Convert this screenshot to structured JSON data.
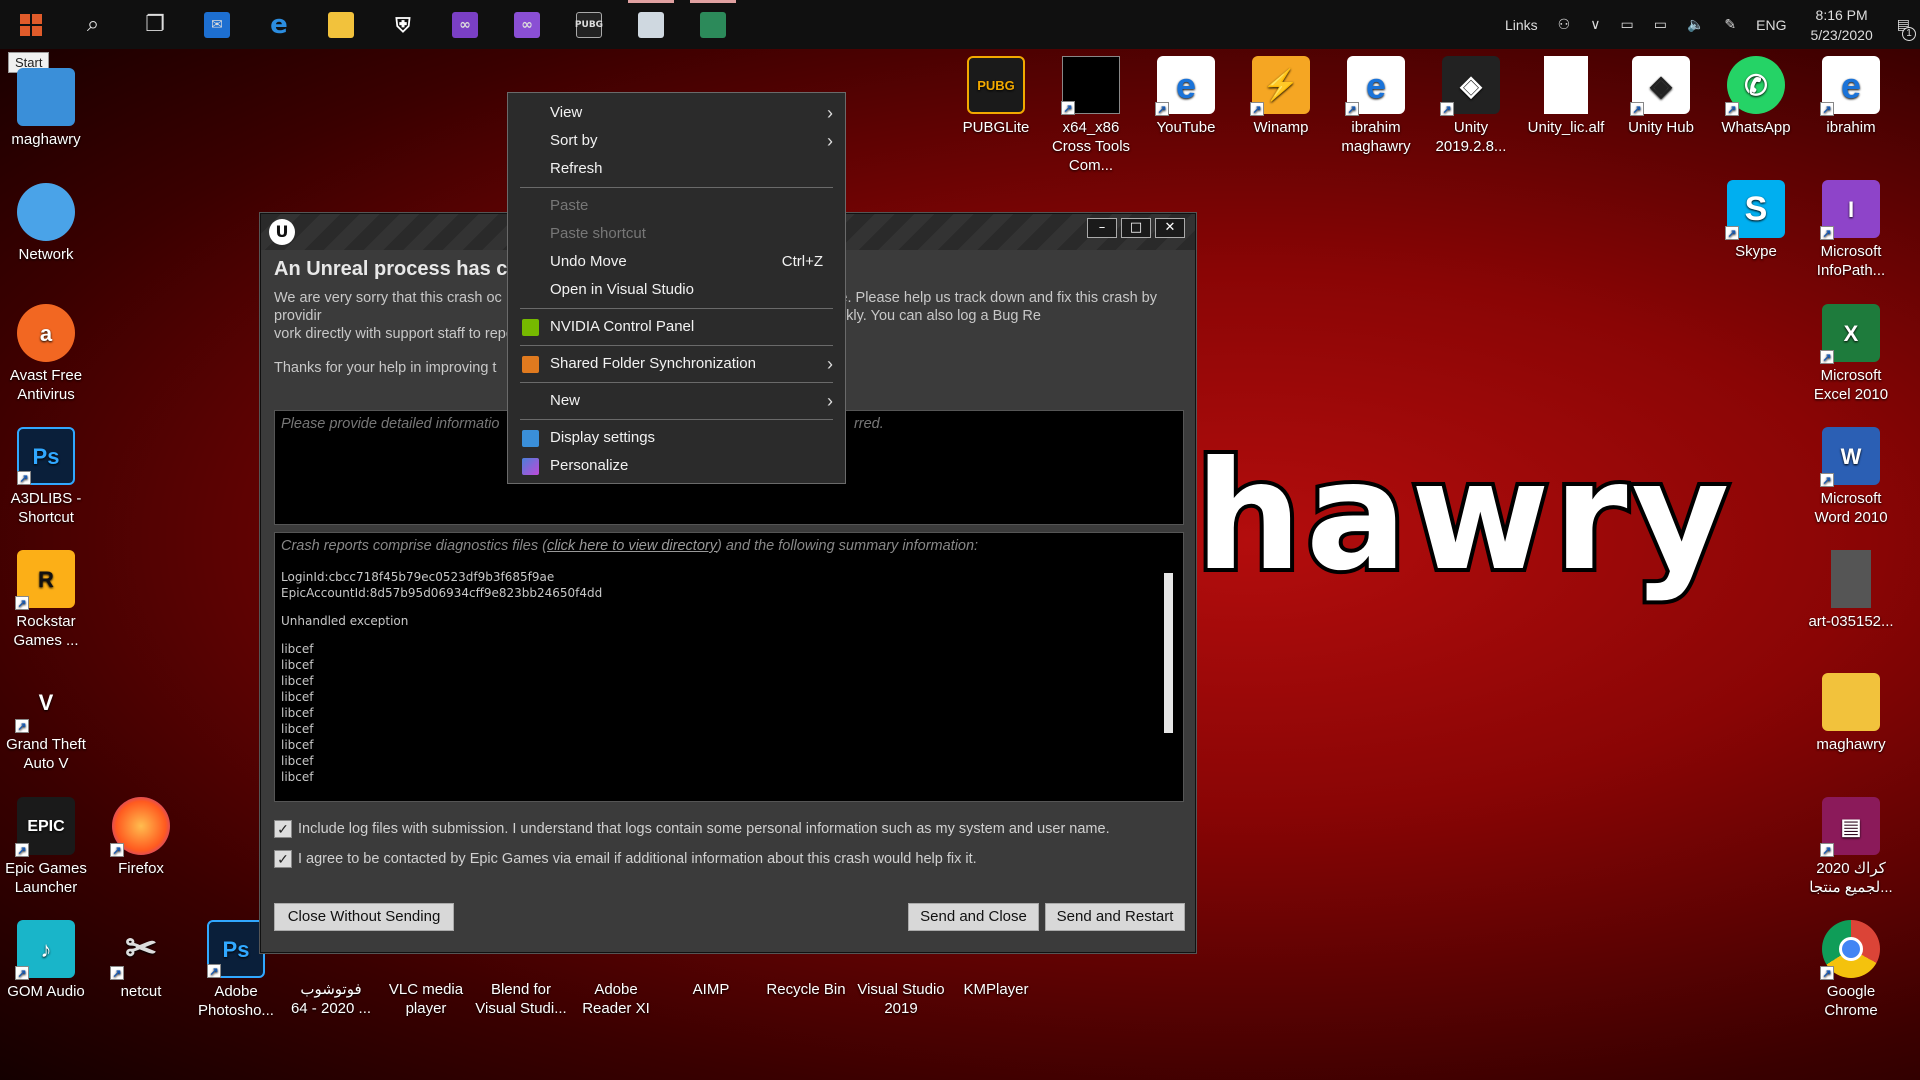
{
  "taskbar": {
    "start_tooltip": "Start",
    "tray": {
      "links": "Links",
      "language": "ENG",
      "time": "8:16 PM",
      "date": "5/23/2020",
      "notification_count": "1"
    }
  },
  "desktop_left": [
    {
      "label": "maghawry"
    },
    {
      "label": "Network"
    },
    {
      "label": "Avast Free Antivirus"
    },
    {
      "label": "A3DLIBS - Shortcut"
    },
    {
      "label": "Rockstar Games ..."
    },
    {
      "label": "Grand Theft Auto V"
    },
    {
      "label": "Epic Games Launcher"
    },
    {
      "label": "GOM Audio"
    }
  ],
  "desktop_col2": [
    {
      "label": "Firefox"
    },
    {
      "label": "netcut"
    }
  ],
  "desktop_bottom": [
    {
      "label": "Adobe Photosho..."
    },
    {
      "label": "فوتوشوب 2020 - 64 ..."
    },
    {
      "label": "VLC media player"
    },
    {
      "label": "Blend for Visual Studi..."
    },
    {
      "label": "Adobe Reader XI"
    },
    {
      "label": "AIMP"
    },
    {
      "label": "Recycle Bin"
    },
    {
      "label": "Visual Studio 2019"
    },
    {
      "label": "KMPlayer"
    }
  ],
  "desktop_top": [
    {
      "label": "PUBGLite"
    },
    {
      "label": "x64_x86 Cross Tools Com..."
    },
    {
      "label": "YouTube"
    },
    {
      "label": "Winamp"
    },
    {
      "label": "ibrahim maghawry"
    },
    {
      "label": "Unity 2019.2.8..."
    },
    {
      "label": "Unity_lic.alf"
    },
    {
      "label": "Unity Hub"
    },
    {
      "label": "WhatsApp"
    },
    {
      "label": "ibrahim"
    }
  ],
  "desktop_right": [
    {
      "label": "Skype"
    },
    {
      "label": "Microsoft InfoPath..."
    },
    {
      "label": "Microsoft Excel 2010"
    },
    {
      "label": "Microsoft Word 2010"
    },
    {
      "label": "art-035152..."
    },
    {
      "label": "maghawry"
    },
    {
      "label": "كراك 2020 لجميع منتجا..."
    },
    {
      "label": "Google Chrome"
    }
  ],
  "wallpaper_text": "hawry",
  "crash_dialog": {
    "heading": "An Unreal process has cra",
    "para1": "We are very sorry that this crash oc                                                   occurring in the future. Please help us track down and fix this crash by providir                                                   so that we may reproduce the crash and fix it quickly. You can also log a Bug Re                                                   vork directly with support staff to report this issue.",
    "para2": "Thanks for your help in improving t",
    "detail_placeholder": "Please provide detailed informatio                                                                                        rred.",
    "report_header_pre": "Crash reports comprise diagnostics files (",
    "report_header_link": "click here to view directory",
    "report_header_post": ") and the following summary information:",
    "login_id": "LoginId:cbcc718f45b79ec0523df9b3f685f9ae",
    "epic_account": "EpicAccountId:8d57b95d06934cff9e823bb24650f4dd",
    "exception": "Unhandled exception",
    "stack": [
      "libcef",
      "libcef",
      "libcef",
      "libcef",
      "libcef",
      "libcef",
      "libcef",
      "libcef",
      "libcef"
    ],
    "check1": "Include log files with submission. I understand that logs contain some personal information such as my system and user name.",
    "check2": "I agree to be contacted by Epic Games via email if additional information about this crash would help fix it.",
    "btn_close": "Close Without Sending",
    "btn_send_close": "Send and Close",
    "btn_send_restart": "Send and Restart"
  },
  "context_menu": {
    "view": "View",
    "sort_by": "Sort by",
    "refresh": "Refresh",
    "paste": "Paste",
    "paste_shortcut": "Paste shortcut",
    "undo_move": "Undo Move",
    "undo_accel": "Ctrl+Z",
    "open_vs": "Open in Visual Studio",
    "nvidia": "NVIDIA Control Panel",
    "shared_sync": "Shared Folder Synchronization",
    "new": "New",
    "display": "Display settings",
    "personalize": "Personalize"
  }
}
